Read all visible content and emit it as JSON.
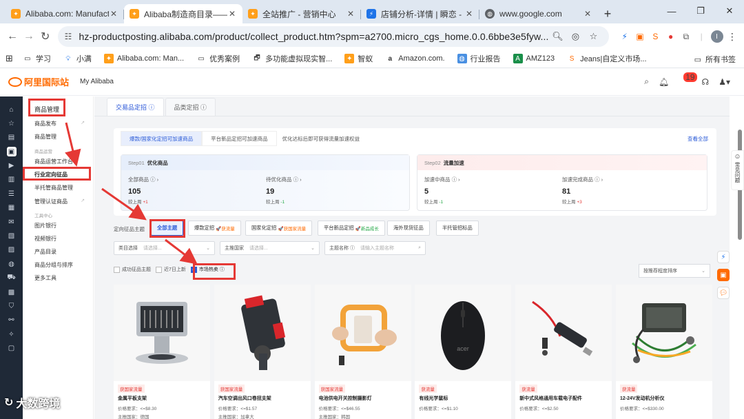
{
  "browser": {
    "tabs": [
      {
        "title": "Alibaba.com: Manufact",
        "icon": "alibaba-icon",
        "color": "#ff6a00",
        "active": false
      },
      {
        "title": "Alibaba制造商目录——",
        "icon": "alibaba-icon",
        "color": "#ff6a00",
        "active": true
      },
      {
        "title": "全站推广 - 营销中心",
        "icon": "alibaba-icon",
        "color": "#ff6a00",
        "active": false
      },
      {
        "title": "店铺分析-详情 | 瞬恋 -",
        "icon": "analytics-icon",
        "color": "#1e73e8",
        "active": false
      },
      {
        "title": "www.google.com",
        "icon": "globe-icon",
        "color": "#5f6368",
        "active": false
      }
    ],
    "url": "hz-productposting.alibaba.com/product/collect_product.htm?spm=a2700.micro_cgs_home.0.0.6bbe3e5fyw...",
    "profile_initial": "I",
    "bookmarks": [
      "学习",
      "小满",
      "Alibaba.com: Man...",
      "优秀案例",
      "多功能虚拟现实智...",
      "智蚁",
      "Amazon.com.",
      "行业报告",
      "AMZ123",
      "Jeans|自定义市场..."
    ],
    "all_bookmarks": "所有书签"
  },
  "header": {
    "logo_text": "阿里国际站",
    "my_alibaba": "My Alibaba",
    "notification_count": "19"
  },
  "sidebar": {
    "section_title": "商品管理",
    "items": [
      {
        "label": "商品发布"
      },
      {
        "label": "商品管理"
      },
      {
        "label": "商品运营",
        "group": true
      },
      {
        "label": "商品运营工作台"
      },
      {
        "label": "行业定向征品",
        "selected": true
      },
      {
        "label": "半托管商品管理"
      },
      {
        "label": "管理认证商品"
      },
      {
        "label": "工具中心",
        "group": true
      },
      {
        "label": "图片银行"
      },
      {
        "label": "视频银行"
      },
      {
        "label": "产品目录"
      },
      {
        "label": "商品分组与排序"
      },
      {
        "label": "更多工具"
      }
    ]
  },
  "main": {
    "tabs": [
      "交易品定招 ⓘ",
      "品类定招 ⓘ"
    ],
    "pills": [
      "爆款/国家化定招可加速商品",
      "平台新品定招可加速商品"
    ],
    "pill_note": "优化达标后即可获得流量加速权益",
    "view_all": "查看全部",
    "step1": {
      "step": "Step01",
      "title": "优化商品",
      "metrics": [
        {
          "label": "全部商品 ⓘ ›",
          "value": "105",
          "compare": "较上周",
          "delta": "+1",
          "dir": "up"
        },
        {
          "label": "待优化商品 ⓘ ›",
          "value": "19",
          "compare": "较上周",
          "delta": "-1",
          "dir": "down"
        }
      ]
    },
    "step2": {
      "step": "Step02",
      "title": "流量加速",
      "metrics": [
        {
          "label": "加速中商品 ⓘ ›",
          "value": "5",
          "compare": "较上周",
          "delta": "-1",
          "dir": "down"
        },
        {
          "label": "加速完成商品 ⓘ ›",
          "value": "81",
          "compare": "较上周",
          "delta": "+3",
          "dir": "up"
        }
      ]
    },
    "filter_label": "定向征品主题",
    "topics": [
      {
        "label": "全部主题",
        "tag": ""
      },
      {
        "label": "爆款定招",
        "tag": "🚀获流量"
      },
      {
        "label": "国家化定招",
        "tag": "🚀获国家流量"
      },
      {
        "label": "平台新品定招",
        "tag": "🚀新品成长"
      },
      {
        "label": "海外现货征品",
        "tag": ""
      },
      {
        "label": "半托管招标品",
        "tag": ""
      }
    ],
    "selects": [
      {
        "label": "类目选择",
        "placeholder": "请选择..."
      },
      {
        "label": "主推国家",
        "placeholder": "请选择..."
      },
      {
        "label": "主题名称 ⓘ",
        "placeholder": "请输入主题名称"
      }
    ],
    "checkboxes": [
      {
        "label": "成功征品主题",
        "checked": false
      },
      {
        "label": "近7日上新",
        "checked": false
      },
      {
        "label": "市场热卖 ⓘ",
        "checked": true
      }
    ],
    "sort": "按推荐程度排序",
    "products": [
      {
        "tag": "获国家流量",
        "name": "金属平板支架",
        "price": "价格要求：<=$8.30",
        "country": "主推国家：德国",
        "icon": "tablet-stand-image"
      },
      {
        "tag": "获国家流量",
        "name": "汽车空调出风口卷扭支架",
        "price": "价格要求：<=$1.57",
        "country": "主推国家：加拿大",
        "icon": "car-phone-mount-image"
      },
      {
        "tag": "获国家流量",
        "name": "电池供电开关控制摄影灯",
        "price": "价格要求：<=$46.55",
        "country": "主推国家：韩国",
        "icon": "ring-light-image"
      },
      {
        "tag": "获流量",
        "name": "有线光学鼠标",
        "price": "价格要求：<=$1.10",
        "country": "",
        "icon": "mouse-image"
      },
      {
        "tag": "获流量",
        "name": "新中式风格通用车载电子配件",
        "price": "价格要求：<=$2.50",
        "country": "",
        "icon": "car-charger-image"
      },
      {
        "tag": "获流量",
        "name": "12-24V发动机分析仪",
        "price": "价格要求：<=$330.00",
        "country": "",
        "icon": "diagnostic-tool-image"
      }
    ]
  },
  "helper": "常见问题",
  "watermark": "大数跨境"
}
